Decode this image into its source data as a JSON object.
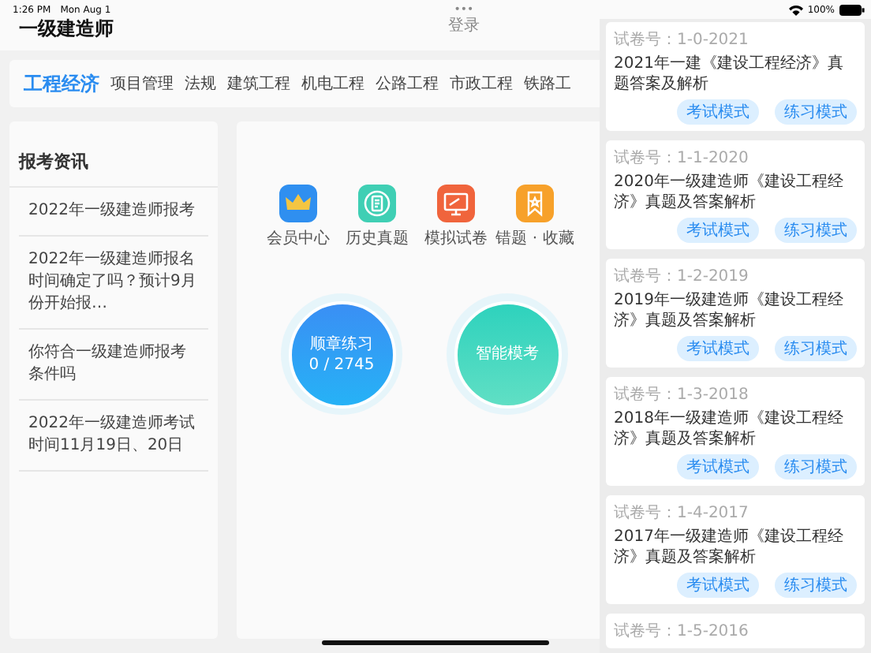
{
  "status_bar": {
    "time": "1:26 PM",
    "date": "Mon Aug 1",
    "battery": "100%"
  },
  "header": {
    "title": "一级建造师",
    "menu_dots": "•••",
    "login": "登录"
  },
  "tabs": [
    {
      "label": "工程经济",
      "selected": true
    },
    {
      "label": "项目管理",
      "selected": false
    },
    {
      "label": "法规",
      "selected": false
    },
    {
      "label": "建筑工程",
      "selected": false
    },
    {
      "label": "机电工程",
      "selected": false
    },
    {
      "label": "公路工程",
      "selected": false
    },
    {
      "label": "市政工程",
      "selected": false
    },
    {
      "label": "铁路工",
      "selected": false
    }
  ],
  "news": {
    "title": "报考资讯",
    "items": [
      "2022年一级建造师报考",
      "2022年一级建造师报名时间确定了吗？预计9月份开始报…",
      "你符合一级建造师报考条件吗",
      "2022年一级建造师考试时间11月19日、20日"
    ]
  },
  "shortcuts": [
    {
      "kind": "crown",
      "label": "会员中心"
    },
    {
      "kind": "document",
      "label": "历史真题"
    },
    {
      "kind": "monitor",
      "label": "模拟试卷"
    },
    {
      "kind": "bookmark",
      "label": "错题 · 收藏"
    }
  ],
  "practice_buttons": [
    {
      "kind": "chapter",
      "label": "顺章练习",
      "progress": "0 / 2745"
    },
    {
      "kind": "exam",
      "label": "智能模考"
    }
  ],
  "papers": [
    {
      "code": "试卷号：1-0-2021",
      "title": "2021年一建《建设工程经济》真题答案及解析",
      "buttons": [
        "考试模式",
        "练习模式"
      ]
    },
    {
      "code": "试卷号：1-1-2020",
      "title": "2020年一级建造师《建设工程经济》真题及答案解析",
      "buttons": [
        "考试模式",
        "练习模式"
      ]
    },
    {
      "code": "试卷号：1-2-2019",
      "title": "2019年一级建造师《建设工程经济》真题及答案解析",
      "buttons": [
        "考试模式",
        "练习模式"
      ]
    },
    {
      "code": "试卷号：1-3-2018",
      "title": "2018年一级建造师《建设工程经济》真题及答案解析",
      "buttons": [
        "考试模式",
        "练习模式"
      ]
    },
    {
      "code": "试卷号：1-4-2017",
      "title": "2017年一级建造师《建设工程经济》真题及答案解析",
      "buttons": [
        "考试模式",
        "练习模式"
      ]
    },
    {
      "code": "试卷号：1-5-2016"
    }
  ]
}
